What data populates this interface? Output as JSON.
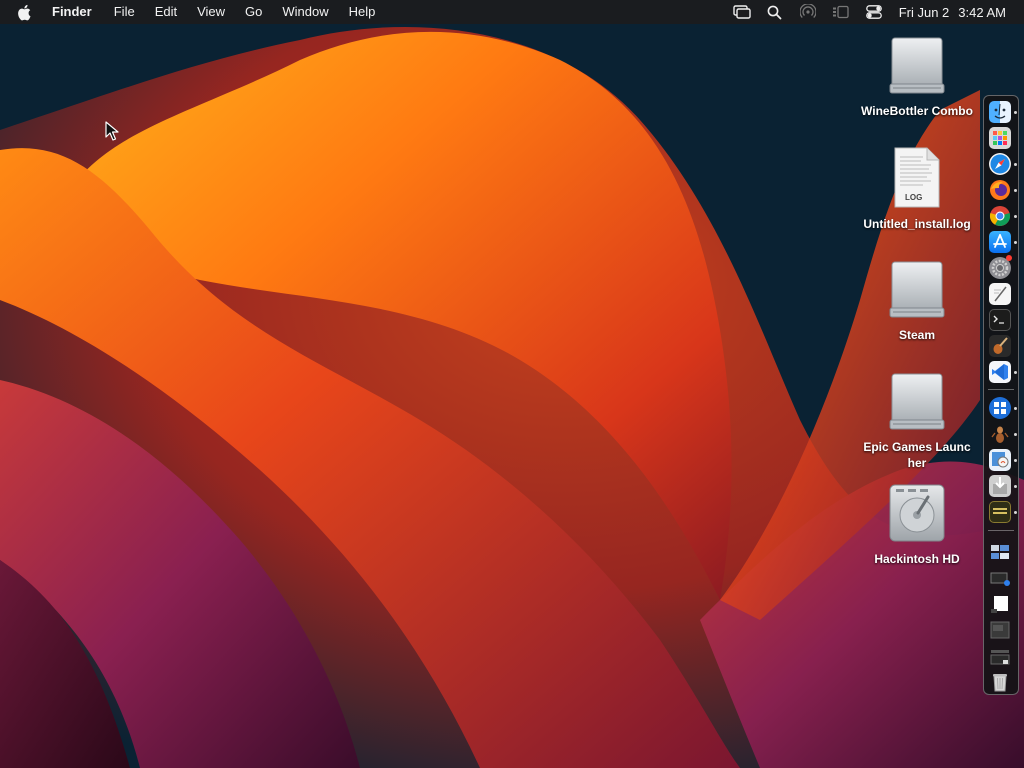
{
  "menubar": {
    "app_name": "Finder",
    "menus": [
      "File",
      "Edit",
      "View",
      "Go",
      "Window",
      "Help"
    ],
    "clock": {
      "date": "Fri Jun 2",
      "time": "3:42 AM"
    }
  },
  "desktop": {
    "icons": [
      {
        "label": "WineBottler Combo",
        "type": "drive"
      },
      {
        "label": "Untitled_install.log",
        "type": "log-file",
        "badge": "LOG"
      },
      {
        "label": "Steam",
        "type": "drive"
      },
      {
        "label": "Epic Games Launcher",
        "type": "drive"
      },
      {
        "label": "Hackintosh HD",
        "type": "hard-disk"
      }
    ]
  },
  "dock": {
    "apps": [
      {
        "name": "finder-icon",
        "color": "#2c9cf0",
        "running": true
      },
      {
        "name": "launchpad-icon",
        "color": "#d8d8d8",
        "running": false
      },
      {
        "name": "safari-icon",
        "color": "#1e88e5",
        "running": true
      },
      {
        "name": "firefox-icon",
        "color": "#ff7a1a",
        "running": true
      },
      {
        "name": "chrome-icon",
        "color": "#4caf50",
        "running": true
      },
      {
        "name": "app-store-icon",
        "color": "#1a8cff",
        "running": true
      },
      {
        "name": "system-preferences-icon",
        "color": "#8e8e93",
        "running": false,
        "badge": true
      },
      {
        "name": "textedit-icon",
        "color": "#f5f5f5",
        "running": false
      },
      {
        "name": "terminal-icon",
        "color": "#222222",
        "running": false
      },
      {
        "name": "guitar-app-icon",
        "color": "#a0522d",
        "running": false
      },
      {
        "name": "vscode-icon",
        "color": "#2f80ed",
        "running": true
      },
      {
        "name": "winebottler-icon",
        "color": "#1e6fd9",
        "running": true
      },
      {
        "name": "ant-app-icon",
        "color": "#b5651d",
        "running": true
      },
      {
        "name": "preview-icon",
        "color": "#4a90d9",
        "running": true
      },
      {
        "name": "installer-icon",
        "color": "#c0c0c0",
        "running": true
      },
      {
        "name": "whisky-app-icon",
        "color": "#3a3a1a",
        "running": true
      }
    ],
    "stack": [
      {
        "name": "downloads-folder-icon"
      },
      {
        "name": "screenshot-stack-icon"
      },
      {
        "name": "document-stack-icon"
      },
      {
        "name": "window-stack-icon"
      },
      {
        "name": "recent-stack-icon"
      }
    ],
    "trash": {
      "name": "trash-icon"
    }
  }
}
